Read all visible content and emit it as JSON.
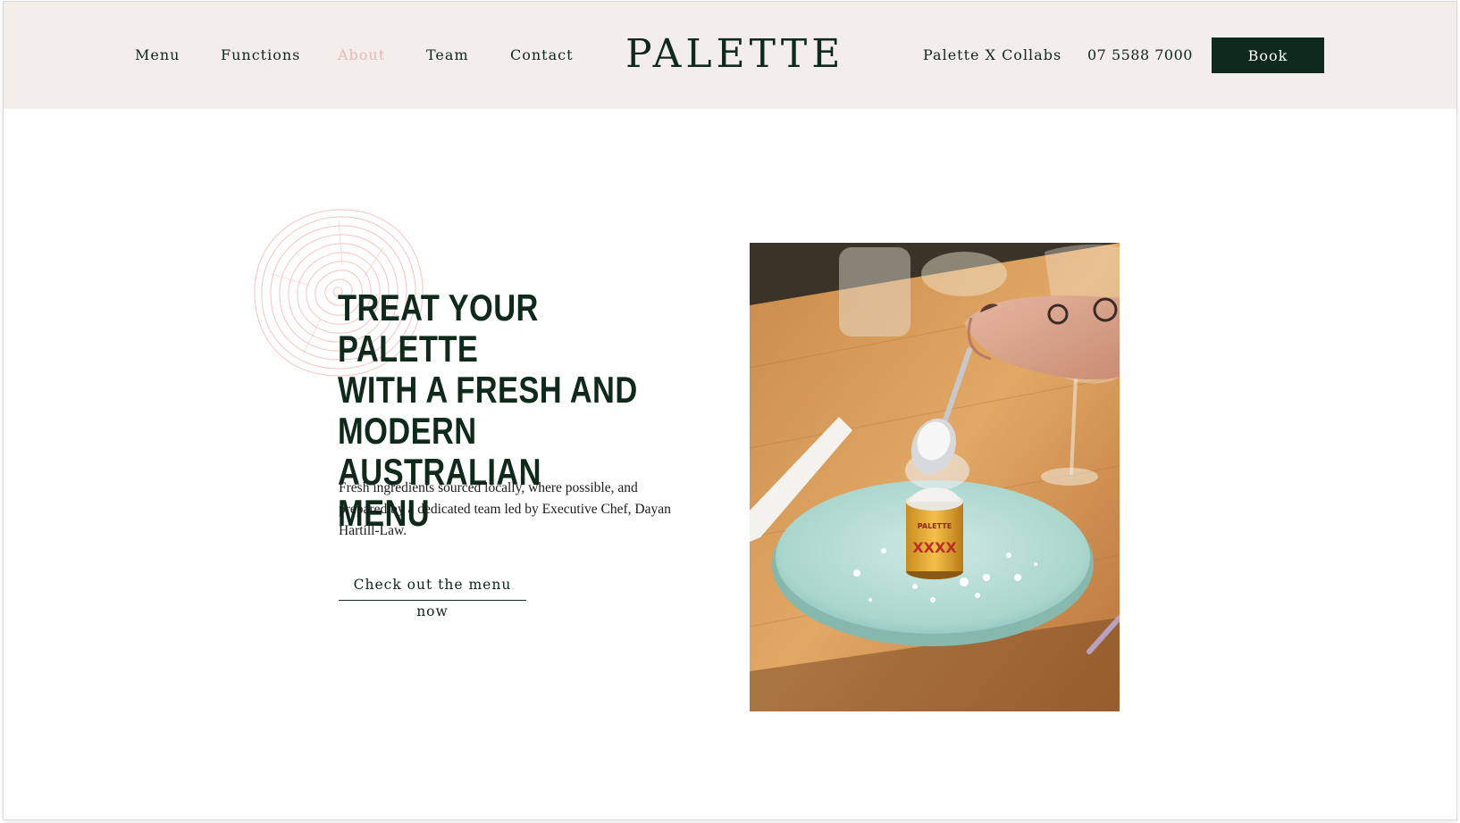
{
  "header": {
    "nav_left": [
      {
        "label": "Menu",
        "active": false
      },
      {
        "label": "Functions",
        "active": false
      },
      {
        "label": "About",
        "active": true
      },
      {
        "label": "Team",
        "active": false
      },
      {
        "label": "Contact",
        "active": false
      }
    ],
    "logo": "PALETTE",
    "collabs_label": "Palette X Collabs",
    "phone": "07 5588 7000",
    "book_label": "Book"
  },
  "hero": {
    "headline_lines": [
      "TREAT YOUR PALETTE",
      "WITH A FRESH AND",
      "MODERN AUSTRALIAN",
      "MENU"
    ],
    "intro_lines": [
      "Fresh ingredients sourced locally, where possible, and",
      "prepared by a dedicated team led by Executive Chef, Dayan",
      "Hartill-Law."
    ],
    "cta_label": "Check out the menu now",
    "jar_label_top": "PALETTE",
    "jar_label_main": "XXXX"
  },
  "colors": {
    "header_bg": "#f3eeea",
    "brand_green": "#0f2a1b",
    "active_nav": "#e7b8b6",
    "ring_pink": "#f2c9c6"
  }
}
